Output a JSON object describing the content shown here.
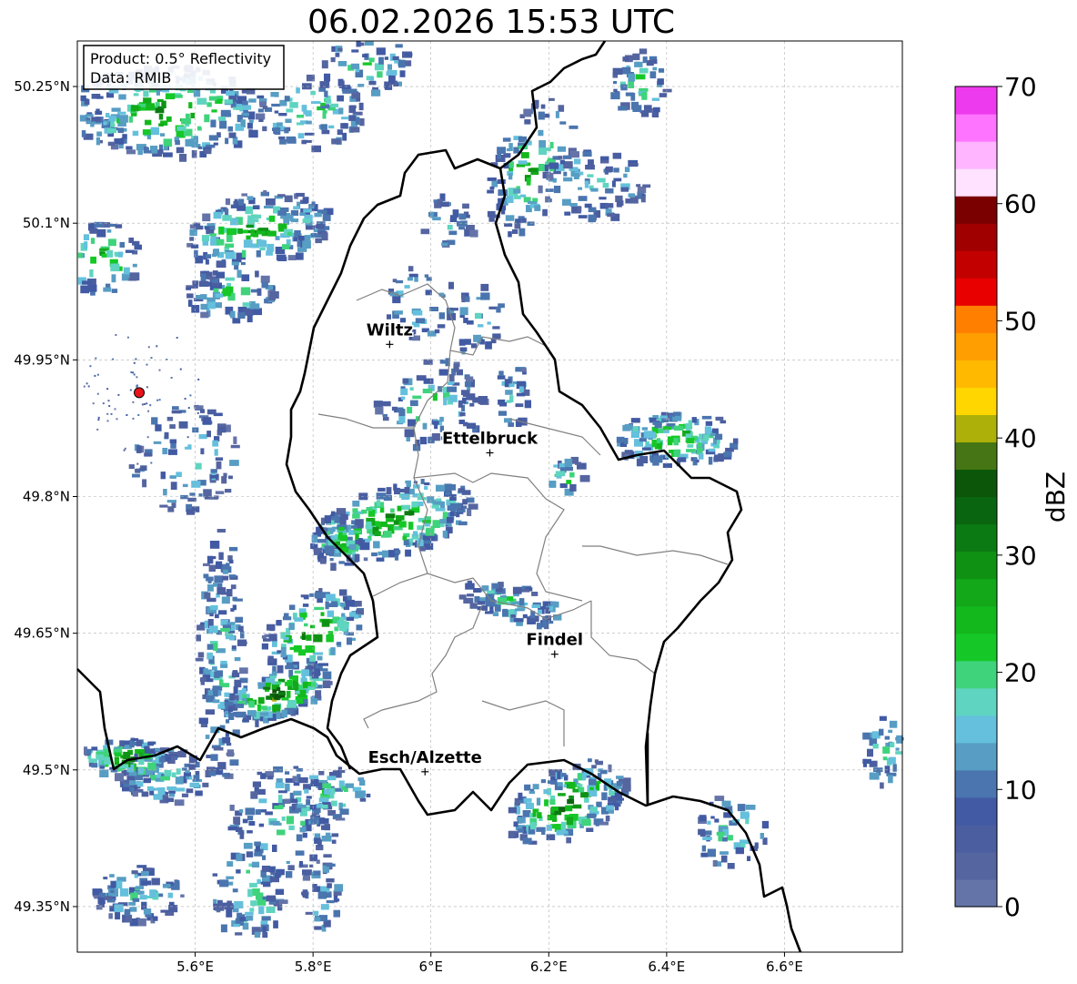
{
  "title": "06.02.2026 15:53 UTC",
  "info_box": {
    "product": "Product: 0.5° Reflectivity",
    "data": "Data: RMIB"
  },
  "axes": {
    "x_ticks": [
      "5.6°E",
      "5.8°E",
      "6°E",
      "6.2°E",
      "6.4°E",
      "6.6°E"
    ],
    "y_ticks": [
      "50.25°N",
      "50.1°N",
      "49.95°N",
      "49.8°N",
      "49.65°N",
      "49.5°N",
      "49.35°N"
    ],
    "lon_range": [
      5.4,
      6.8
    ],
    "lat_range": [
      49.3,
      50.3
    ],
    "grid": true
  },
  "cities": [
    {
      "name": "Wiltz",
      "lon": 5.93,
      "lat": 49.967
    },
    {
      "name": "Ettelbruck",
      "lon": 6.1,
      "lat": 49.848
    },
    {
      "name": "Findel",
      "lon": 6.21,
      "lat": 49.627
    },
    {
      "name": "Esch/Alzette",
      "lon": 5.99,
      "lat": 49.498
    }
  ],
  "radar_site": {
    "lon": 5.505,
    "lat": 49.914,
    "color": "#e8141c"
  },
  "colorbar": {
    "label": "dBZ",
    "min": 0,
    "max": 70,
    "step": 2.5,
    "tick_labels": [
      "0",
      "10",
      "20",
      "30",
      "40",
      "50",
      "60",
      "70"
    ],
    "colors": [
      "#6574a8",
      "#5565a0",
      "#4a5ea0",
      "#415aa3",
      "#4a75ae",
      "#579dc4",
      "#64c0dc",
      "#5fd4c0",
      "#3fd37c",
      "#15c827",
      "#13b81d",
      "#12a81a",
      "#0f9214",
      "#0c7a12",
      "#0a6510",
      "#0b5609",
      "#457515",
      "#adb009",
      "#ffd600",
      "#ffba00",
      "#ff9e00",
      "#ff7f00",
      "#e80000",
      "#c30000",
      "#a00000",
      "#7a0000",
      "#ffe2ff",
      "#ffb5ff",
      "#ff74ff",
      "#ee3aee"
    ]
  }
}
